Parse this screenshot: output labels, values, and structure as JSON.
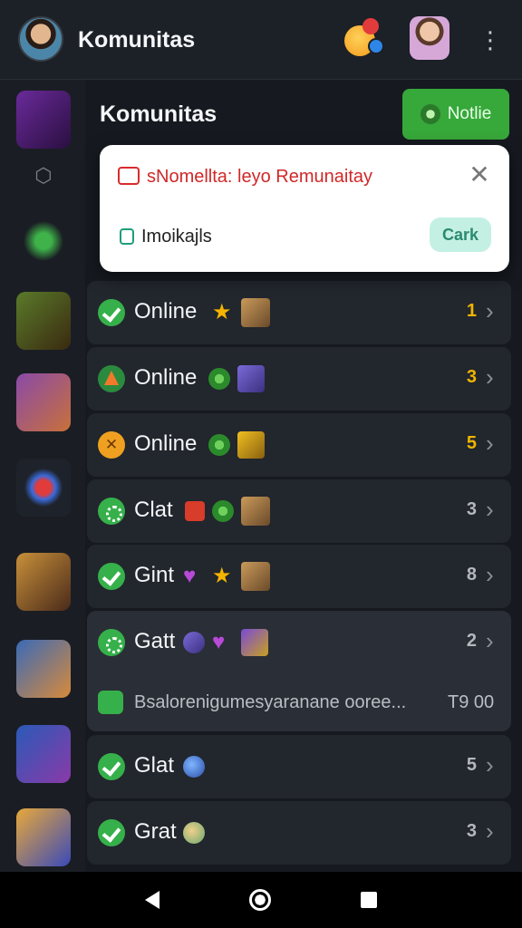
{
  "app": {
    "title": "Komunitas"
  },
  "header": {
    "more_icon": "⋮"
  },
  "section": {
    "title": "Komunitas",
    "notice_button": "Notlie"
  },
  "popup": {
    "title": "sNomelltа: leyo Remunaitay",
    "subtitle": "Imoikajls",
    "cta": "Cark",
    "close": "✕"
  },
  "rows": [
    {
      "label": "Online",
      "count": "1",
      "count_color": "gold"
    },
    {
      "label": "Online",
      "count": "3",
      "count_color": "gold"
    },
    {
      "label": "Online",
      "count": "5",
      "count_color": "gold"
    },
    {
      "label": "Clat",
      "count": "3",
      "count_color": "grey"
    },
    {
      "label": "Gint",
      "count": "8",
      "count_color": "grey"
    },
    {
      "label": "Gatt",
      "count": "2",
      "count_color": "grey",
      "preview": "Bsalorenigumesyaranane ooree...",
      "time": "T9 00"
    },
    {
      "label": "Glat",
      "count": "5",
      "count_color": "grey"
    },
    {
      "label": "Grat",
      "count": "3",
      "count_color": "grey"
    }
  ],
  "colors": {
    "accent_green": "#37a83a",
    "count_gold": "#f0b400",
    "background": "#161a20"
  }
}
